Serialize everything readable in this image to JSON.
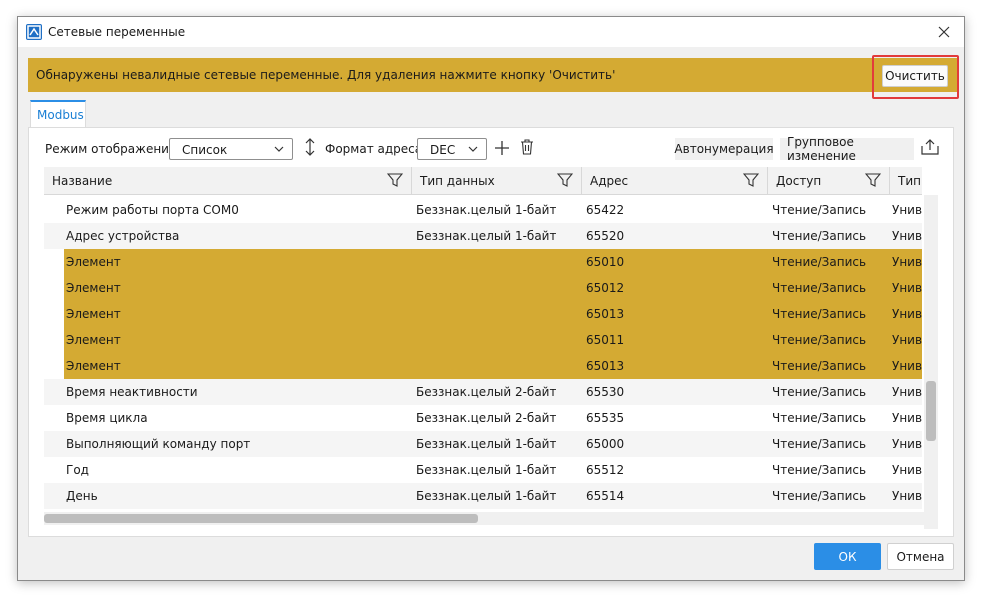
{
  "window": {
    "title": "Сетевые переменные",
    "app_icon": "app-logo-icon",
    "close_icon": "close-icon"
  },
  "banner": {
    "message": "Обнаружены невалидные сетевые переменные. Для удаления нажмите кнопку 'Очистить'",
    "clear_label": "Очистить",
    "color": "#d4aa33"
  },
  "tabs": [
    {
      "label": "Modbus",
      "active": true
    }
  ],
  "toolbar": {
    "display_mode_label": "Режим отображения:",
    "display_mode_value": "Список",
    "address_format_label": "Формат адреса:",
    "address_format_value": "DEC",
    "autonumber_label": "Автонумерация",
    "group_edit_label": "Групповое изменение"
  },
  "table": {
    "columns": [
      "Название",
      "Тип данных",
      "Адрес",
      "Доступ",
      "Тип р"
    ],
    "rows": [
      {
        "name": "Режим работы порта COM0",
        "type": "Беззнак.целый 1-байт",
        "address": "65422",
        "access": "Чтение/Запись",
        "kind": "Униве",
        "invalid": false
      },
      {
        "name": "Адрес устройства",
        "type": "Беззнак.целый 1-байт",
        "address": "65520",
        "access": "Чтение/Запись",
        "kind": "Униве",
        "invalid": false
      },
      {
        "name": "Элемент",
        "type": "",
        "address": "65010",
        "access": "Чтение/Запись",
        "kind": "Униве",
        "invalid": true
      },
      {
        "name": "Элемент",
        "type": "",
        "address": "65012",
        "access": "Чтение/Запись",
        "kind": "Униве",
        "invalid": true
      },
      {
        "name": "Элемент",
        "type": "",
        "address": "65013",
        "access": "Чтение/Запись",
        "kind": "Униве",
        "invalid": true
      },
      {
        "name": "Элемент",
        "type": "",
        "address": "65011",
        "access": "Чтение/Запись",
        "kind": "Униве",
        "invalid": true
      },
      {
        "name": "Элемент",
        "type": "",
        "address": "65013",
        "access": "Чтение/Запись",
        "kind": "Униве",
        "invalid": true
      },
      {
        "name": "Время неактивности",
        "type": "Беззнак.целый 2-байт",
        "address": "65530",
        "access": "Чтение/Запись",
        "kind": "Униве",
        "invalid": false
      },
      {
        "name": "Время цикла",
        "type": "Беззнак.целый 2-байт",
        "address": "65535",
        "access": "Чтение/Запись",
        "kind": "Униве",
        "invalid": false
      },
      {
        "name": "Выполняющий команду порт",
        "type": "Беззнак.целый 1-байт",
        "address": "65000",
        "access": "Чтение/Запись",
        "kind": "Униве",
        "invalid": false
      },
      {
        "name": "Год",
        "type": "Беззнак.целый 1-байт",
        "address": "65512",
        "access": "Чтение/Запись",
        "kind": "Униве",
        "invalid": false
      },
      {
        "name": "День",
        "type": "Беззнак.целый 1-байт",
        "address": "65514",
        "access": "Чтение/Запись",
        "kind": "Униве",
        "invalid": false
      }
    ]
  },
  "footer": {
    "ok_label": "ОК",
    "cancel_label": "Отмена",
    "ok_color": "#2b8ee6"
  }
}
